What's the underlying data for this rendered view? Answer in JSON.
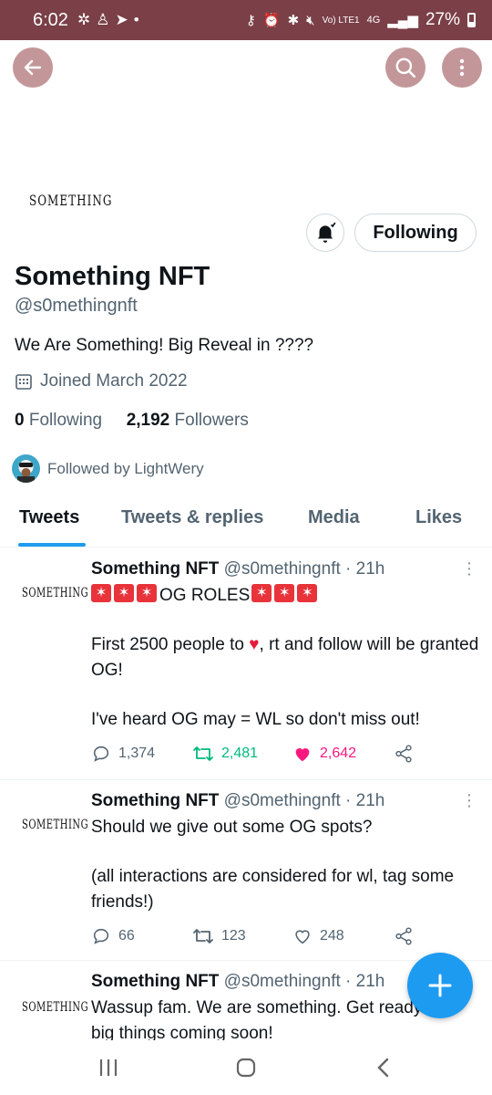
{
  "status_bar": {
    "time": "6:02",
    "left_icons": [
      "gear-icon",
      "person-icon",
      "send-icon",
      "dot-icon"
    ],
    "signal_text": "Vo) LTE1",
    "network": "4G",
    "battery": "27%"
  },
  "profile": {
    "brand_logo": "SOMETHING",
    "name": "Something NFT",
    "handle": "@s0methingnft",
    "bio": "We Are Something!  Big Reveal in ????",
    "joined": "Joined March 2022",
    "following_count": "0",
    "following_label": "Following",
    "followers_count": "2,192",
    "followers_label": "Followers",
    "followed_by": "Followed by LightWery",
    "follow_button": "Following"
  },
  "tabs": [
    {
      "label": "Tweets",
      "active": true
    },
    {
      "label": "Tweets & replies",
      "active": false
    },
    {
      "label": "Media",
      "active": false
    },
    {
      "label": "Likes",
      "active": false
    }
  ],
  "tweets": [
    {
      "avatar_text": "SOMETHING",
      "name": "Something NFT",
      "meta": "@s0methingnft · 21h",
      "title": "OG ROLES",
      "lines": [
        "First 2500 people to",
        ", rt and follow will be granted OG!",
        "I've heard OG may = WL so don't miss out!"
      ],
      "replies": "1,374",
      "retweets": "2,481",
      "likes": "2,642",
      "retweeted": true,
      "liked": true
    },
    {
      "avatar_text": "SOMETHING",
      "name": "Something NFT",
      "meta": "@s0methingnft · 21h",
      "lines": [
        "Should we give out some OG spots?",
        "(all interactions are considered for wl, tag some friends!)"
      ],
      "replies": "66",
      "retweets": "123",
      "likes": "248",
      "retweeted": false,
      "liked": false
    },
    {
      "avatar_text": "SOMETHING",
      "name": "Something NFT",
      "meta": "@s0methingnft · 21h",
      "lines": [
        "Wassup fam. We are something. Get ready",
        "big things coming soon!"
      ]
    }
  ],
  "colors": {
    "status_bar": "#7a3f47",
    "header_buttons": "#c3979a",
    "accent": "#1d9bf0",
    "retweet_active": "#00ba7c",
    "like_active": "#f91880",
    "secondary_text": "#536471"
  }
}
